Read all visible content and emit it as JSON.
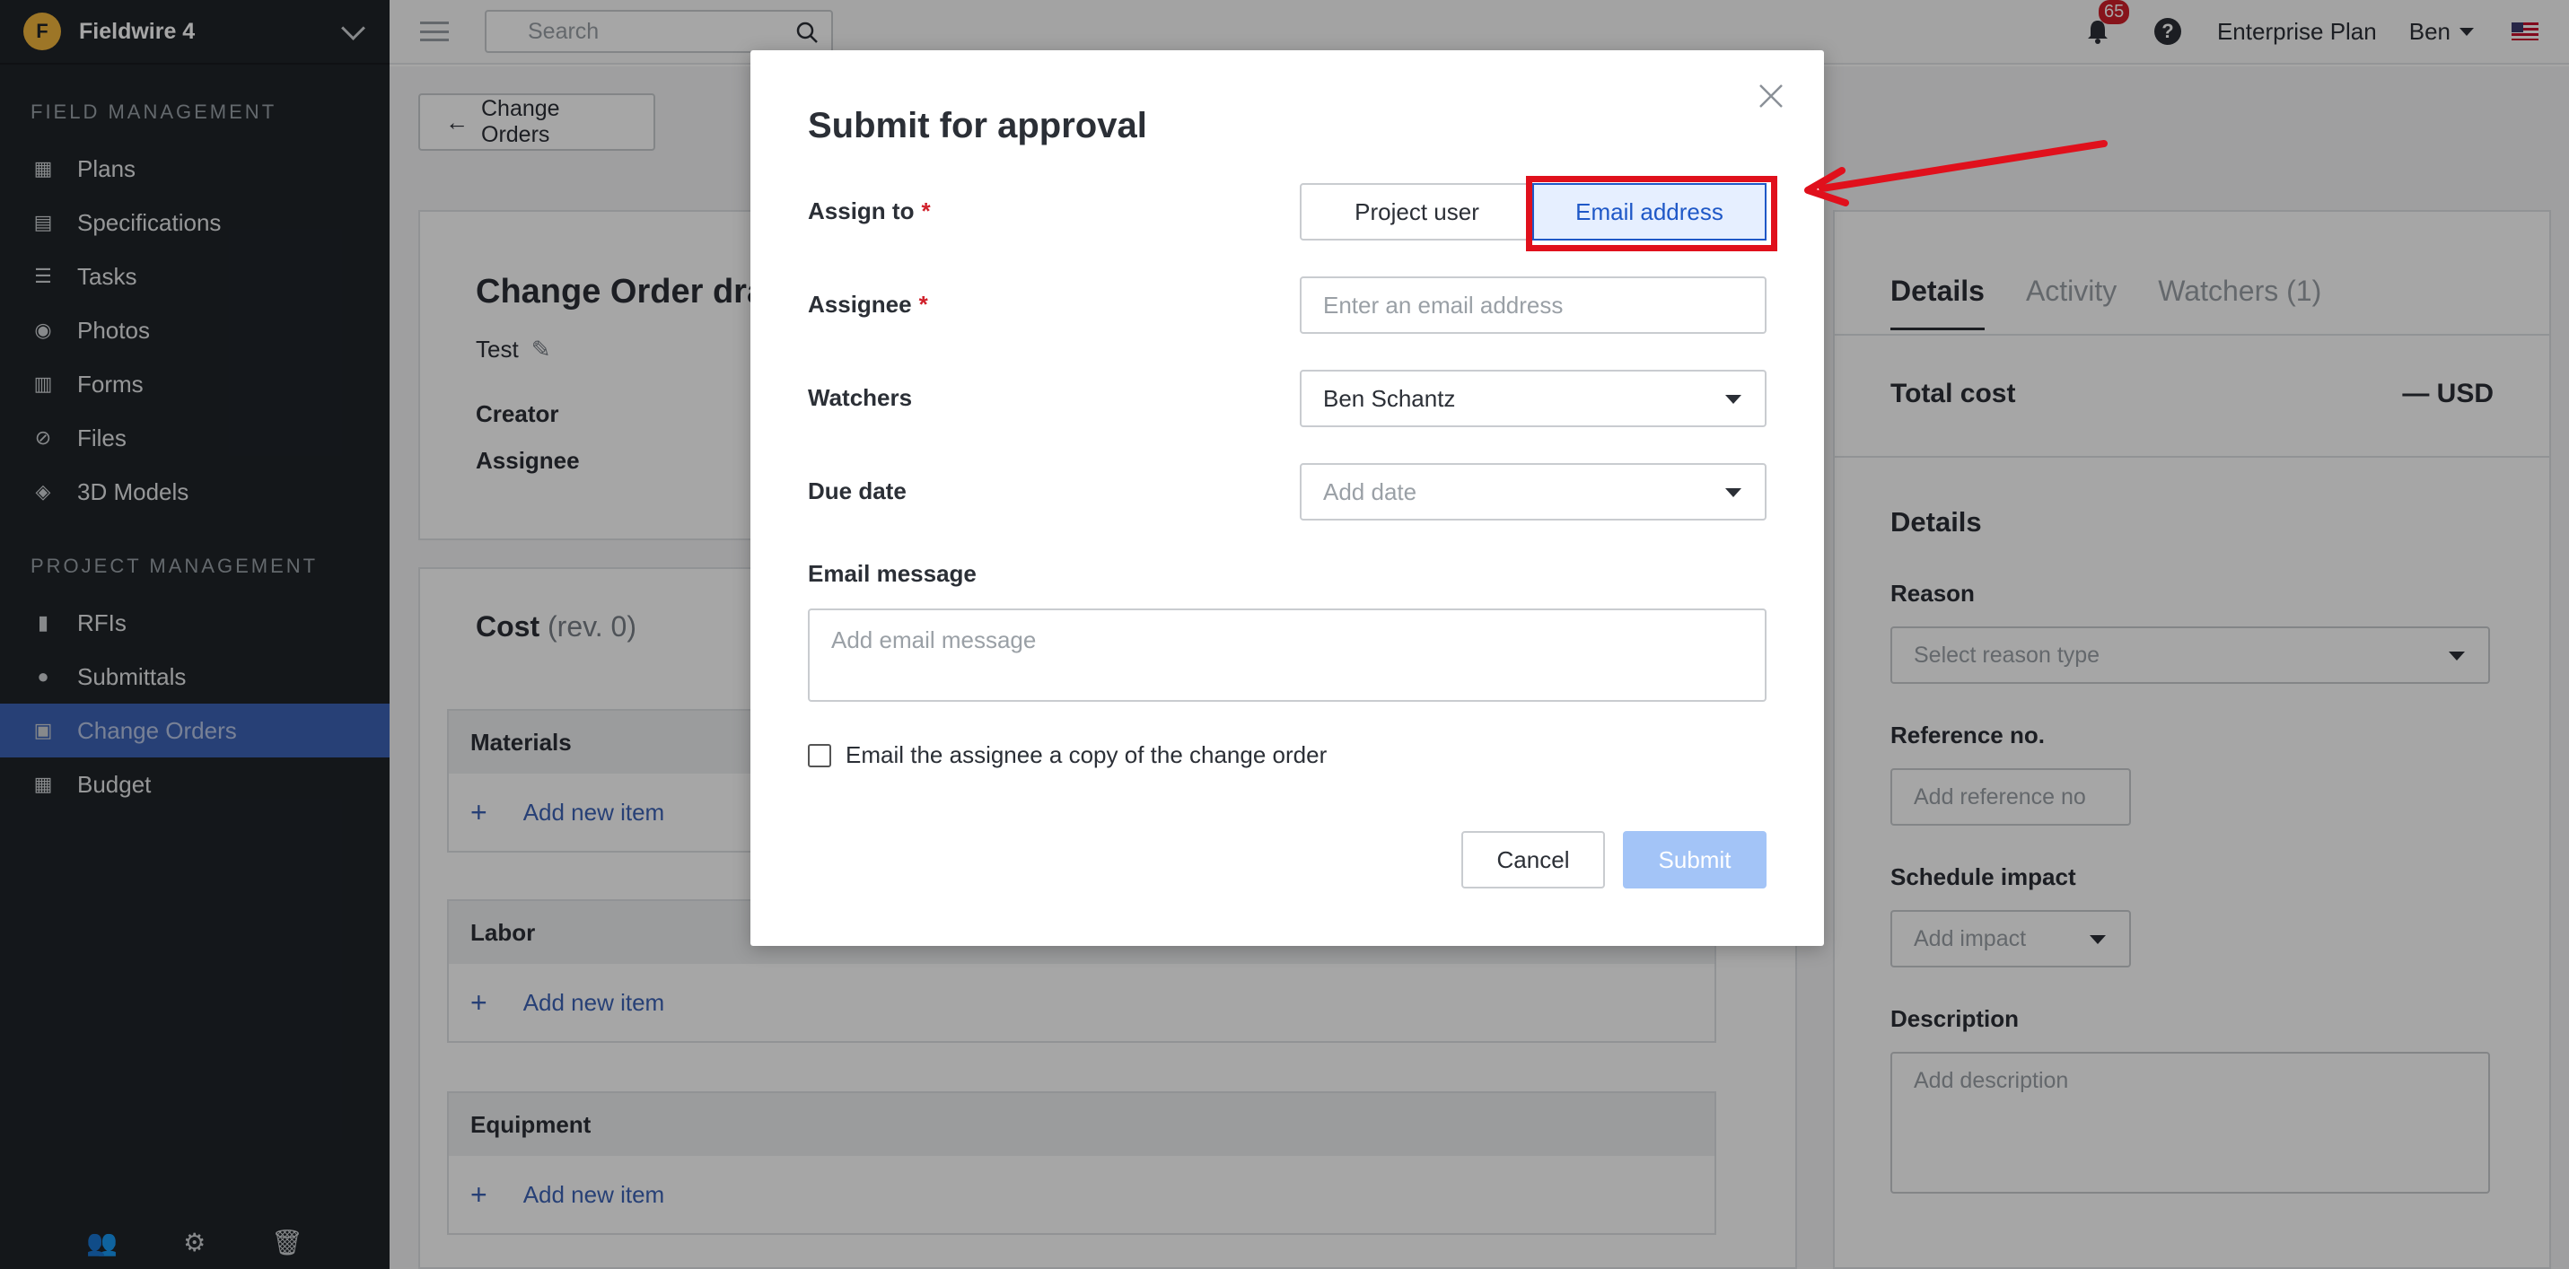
{
  "sidebar": {
    "project_name": "Fieldwire 4",
    "logo_letter": "F",
    "sections": {
      "field_management": "FIELD MANAGEMENT",
      "project_management": "PROJECT MANAGEMENT"
    },
    "field_items": [
      {
        "label": "Plans",
        "icon": "plans-icon"
      },
      {
        "label": "Specifications",
        "icon": "specifications-icon"
      },
      {
        "label": "Tasks",
        "icon": "tasks-icon"
      },
      {
        "label": "Photos",
        "icon": "camera-icon"
      },
      {
        "label": "Forms",
        "icon": "forms-icon"
      },
      {
        "label": "Files",
        "icon": "paperclip-icon"
      },
      {
        "label": "3D Models",
        "icon": "cube-icon"
      }
    ],
    "project_items": [
      {
        "label": "RFIs",
        "icon": "rfi-icon"
      },
      {
        "label": "Submittals",
        "icon": "submittals-icon"
      },
      {
        "label": "Change Orders",
        "icon": "change-orders-icon",
        "active": true
      },
      {
        "label": "Budget",
        "icon": "calculator-icon"
      }
    ],
    "bottom_icons": [
      "users-icon",
      "gear-icon",
      "trash-icon"
    ]
  },
  "topbar": {
    "search_placeholder": "Search",
    "notification_count": "65",
    "help": "?",
    "plan": "Enterprise Plan",
    "user": "Ben"
  },
  "main": {
    "back_label": "Change Orders",
    "title": "Change Order dra",
    "subtitle": "Test",
    "creator_label": "Creator",
    "assignee_label": "Assignee",
    "cost_title": "Cost",
    "cost_rev": "(rev. 0)",
    "cost_sections": [
      {
        "title": "Materials",
        "add": "Add new item"
      },
      {
        "title": "Labor",
        "add": "Add new item"
      },
      {
        "title": "Equipment",
        "add": "Add new item"
      }
    ]
  },
  "right_panel": {
    "tabs": [
      "Details",
      "Activity",
      "Watchers (1)"
    ],
    "total_cost_label": "Total cost",
    "total_cost_value": "— USD",
    "details_title": "Details",
    "reason_label": "Reason",
    "reason_placeholder": "Select reason type",
    "reference_label": "Reference no.",
    "reference_placeholder": "Add reference no",
    "schedule_label": "Schedule impact",
    "schedule_placeholder": "Add impact",
    "description_label": "Description",
    "description_placeholder": "Add description"
  },
  "modal": {
    "title": "Submit for approval",
    "assign_label": "Assign to",
    "required_mark": "*",
    "assign_options": [
      "Project user",
      "Email address"
    ],
    "assign_selected": "Email address",
    "assignee_label": "Assignee",
    "assignee_placeholder": "Enter an email address",
    "watchers_label": "Watchers",
    "watchers_value": "Ben Schantz",
    "due_label": "Due date",
    "due_placeholder": "Add date",
    "email_message_label": "Email message",
    "email_message_placeholder": "Add email message",
    "checkbox_label": "Email the assignee a copy of the change order",
    "cancel_label": "Cancel",
    "submit_label": "Submit"
  },
  "colors": {
    "sidebar_bg": "#1f2429",
    "active_item": "#3d63b5",
    "accent_blue": "#1f58c7",
    "annotation_red": "#e0101c",
    "submit_disabled": "#a3c4f7"
  }
}
